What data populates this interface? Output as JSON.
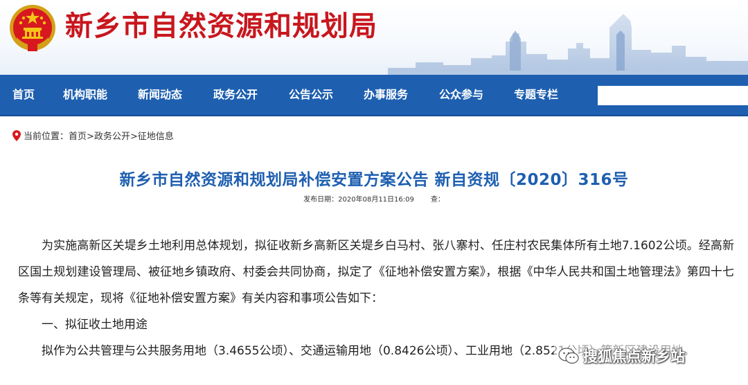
{
  "header": {
    "site_title": "新乡市自然资源和规划局"
  },
  "nav": {
    "items": [
      "首页",
      "机构职能",
      "新闻动态",
      "政务公开",
      "公告公示",
      "办事服务",
      "公众参与",
      "专题专栏"
    ],
    "search_placeholder": ""
  },
  "breadcrumb": {
    "prefix": "当前位置：",
    "home": "首页",
    "sep1": ">",
    "section": "政务公开",
    "sep2": ">",
    "current": "征地信息"
  },
  "article": {
    "title": "新乡市自然资源和规划局补偿安置方案公告 新自资规〔2020〕316号",
    "publish_date": "发布日期：2020年08月11日16:09",
    "views": "查：",
    "paragraphs": [
      "为实施高新区关堤乡土地利用总体规划，拟征收新乡高新区关堤乡白马村、张八寨村、任庄村农民集体所有土地7.1602公顷。经高新区国土规划建设管理局、被征地乡镇政府、村委会共同协商，拟定了《征地补偿安置方案》，根据《中华人民共和国土地管理法》第四十七条等有关规定，现将《征地补偿安置方案》有关内容和事项公告如下：",
      "一、拟征收土地用途",
      "拟作为公共管理与公共服务用地（3.4655公顷）、交通运输用地（0.8426公顷）、工业用地（2.8521公顷）等新区建设用地。"
    ]
  },
  "watermark": {
    "text": "搜狐焦点新乡站",
    "icon": "wechat-icon"
  },
  "colors": {
    "title_red": "#c8161d",
    "nav_blue": "#1e5fb0",
    "article_title_blue": "#1e5fb0"
  }
}
